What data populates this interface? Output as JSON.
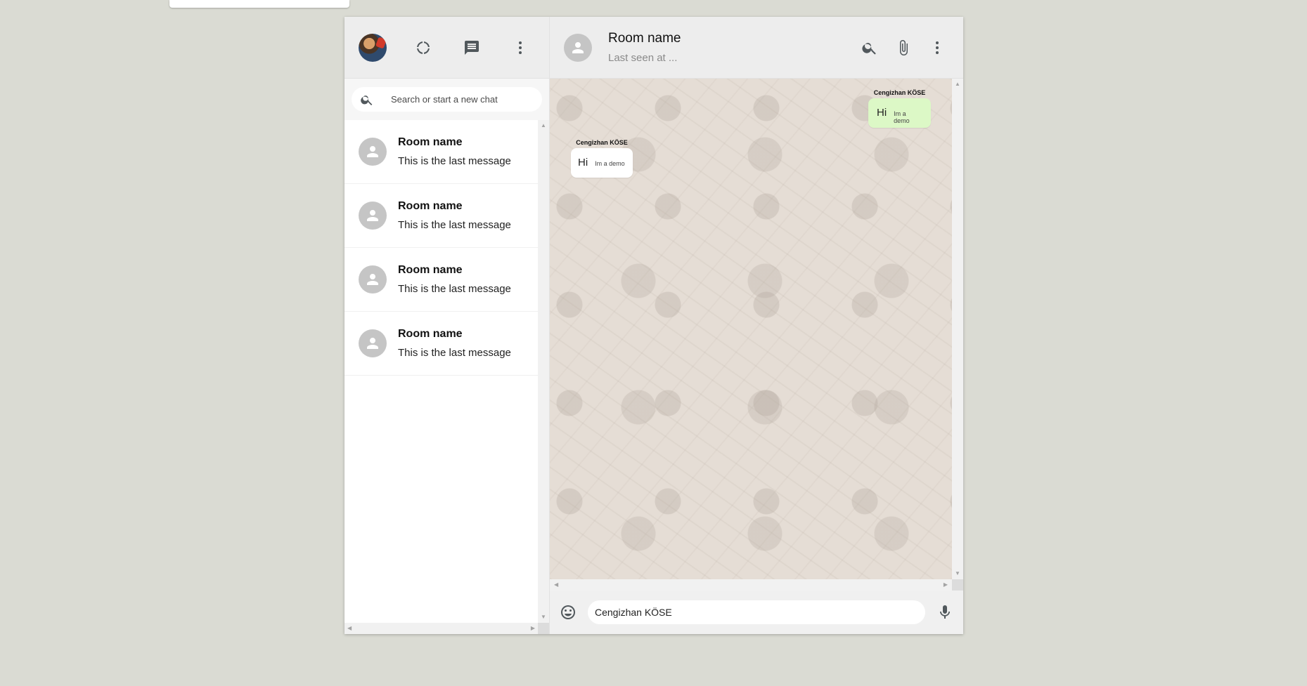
{
  "sidebar": {
    "header": {
      "avatar_icon": "user-photo",
      "status_icon": "status-ring-icon",
      "new_chat_icon": "chat-icon",
      "menu_icon": "more-vert-icon"
    },
    "search": {
      "placeholder": "Search or start a new chat",
      "icon": "search-icon"
    },
    "chats": [
      {
        "name": "Room name",
        "last_message": "This is the last message"
      },
      {
        "name": "Room name",
        "last_message": "This is the last message"
      },
      {
        "name": "Room name",
        "last_message": "This is the last message"
      },
      {
        "name": "Room name",
        "last_message": "This is the last message"
      }
    ]
  },
  "chat": {
    "header": {
      "room_name": "Room name",
      "status": "Last seen at ...",
      "icons": [
        "search-icon",
        "attach-icon",
        "more-vert-icon"
      ]
    },
    "messages": [
      {
        "type": "received",
        "sender": "Cengizhan KÖSE",
        "text": "Hi",
        "subtext": "Im a demo"
      },
      {
        "type": "sent",
        "sender": "Cengizhan KÖSE",
        "text": "Hi",
        "subtext": "Im a demo"
      }
    ],
    "footer": {
      "input_value": "Cengizhan KÖSE",
      "emoji_icon": "emoji-icon",
      "mic_icon": "mic-icon"
    }
  },
  "colors": {
    "background": "#dadbd3",
    "header": "#ededed",
    "sent_bubble": "#dcf8c6",
    "received_bubble": "#ffffff",
    "chat_wallpaper": "#e5ddd5"
  }
}
